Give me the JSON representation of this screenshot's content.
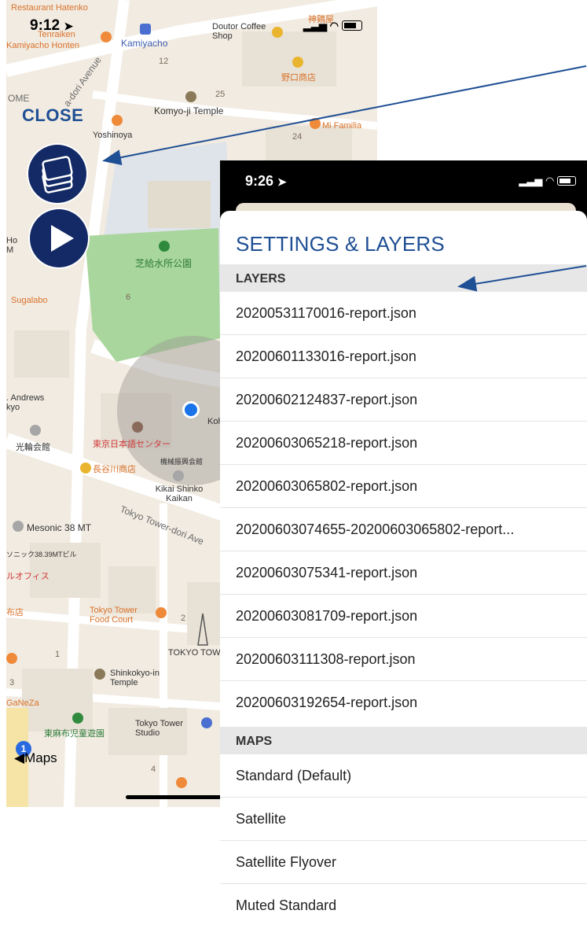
{
  "left_screen": {
    "status_time": "9:12",
    "close_label": "CLOSE",
    "maps_back_label": "Maps",
    "maps_badge": "1",
    "map_labels": {
      "restaurant_hatenko": "Restaurant Hatenko",
      "tenraiken": "Tenraiken",
      "kamiyacho_honten": "Kamiyacho Honten",
      "kamiyacho": "Kamiyacho",
      "doutor": "Doutor Coffee Shop",
      "jp_shop1": "神鶏屋",
      "jp_shop2": "野口商店",
      "ome": "OME",
      "avenue": "a-dori Avenue",
      "komyoji": "Komyo-ji Temple",
      "yoshinoya": "Yoshinoya",
      "mi_familia": "Mi Familia",
      "park": "芝給水所公園",
      "sugalabo": "Sugalabo",
      "hom": "Ho M",
      "andrews": ". Andrews kyo",
      "kourin": "光輪会館",
      "tokyo_nihongo": "東京日本語センター",
      "hasegawa": "長谷川商店",
      "kikai": "機械振興会館",
      "kikai_en": "Kikai Shinko Kaikan",
      "kohoji": "Koho-ji",
      "tower_dori": "Tokyo Tower-dori Ave",
      "mesonic": "Mesonic 38 MT",
      "mesonic_jp": "ソニック38.39MTビル",
      "office": "ルオフィス",
      "shop": "布店",
      "food_court": "Tokyo Tower Food Court",
      "tokyo_tower": "TOKYO TOW",
      "shinkokyo": "Shinkokyo-in Temple",
      "ganeza": "GaNeZa",
      "higashi_azabu": "東麻布児童遊園",
      "studio": "Tokyo Tower Studio",
      "num_12": "12",
      "num_25": "25",
      "num_24": "24",
      "num_6": "6",
      "num_2": "2",
      "num_3": "3",
      "num_4": "4",
      "num_1": "1"
    }
  },
  "right_screen": {
    "status_time": "9:26",
    "title": "SETTINGS & LAYERS",
    "layers_header": "LAYERS",
    "layers": [
      "20200531170016-report.json",
      "20200601133016-report.json",
      "20200602124837-report.json",
      "20200603065218-report.json",
      "20200603065802-report.json",
      "20200603074655-20200603065802-report...",
      "20200603075341-report.json",
      "20200603081709-report.json",
      "20200603111308-report.json",
      "20200603192654-report.json"
    ],
    "maps_header": "MAPS",
    "maps": [
      "Standard (Default)",
      "Satellite",
      "Satellite Flyover",
      "Muted Standard"
    ]
  },
  "colors": {
    "accent_blue": "#1f4f94",
    "button_navy": "#132a66",
    "arrow_blue": "#1f4f94",
    "location_dot": "#1a73e8"
  }
}
